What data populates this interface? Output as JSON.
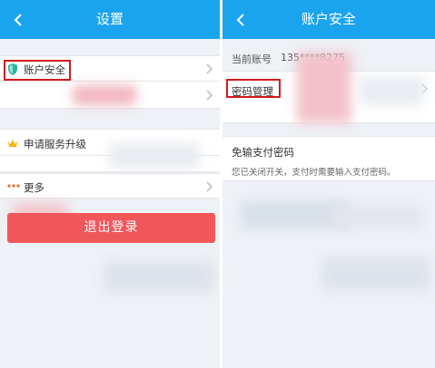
{
  "left": {
    "title": "设置",
    "items": {
      "account_security": "账户安全",
      "service_upgrade": "申请服务升级",
      "more": "更多"
    },
    "logout_label": "退出登录"
  },
  "right": {
    "title": "账户安全",
    "phone_label": "当前账号",
    "phone_value": "135****8275",
    "password_mgmt": "密码管理",
    "nopass_title": "免输支付密码",
    "nopass_desc": "您已关闭开关，支付时需要输入支付密码。"
  },
  "colors": {
    "titlebar": "#1ba4ee",
    "highlight": "#d21a1a",
    "logout": "#f0575a"
  }
}
